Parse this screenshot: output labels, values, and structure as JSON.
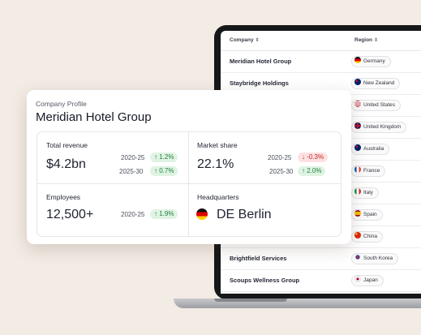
{
  "table": {
    "header_company": "Company",
    "header_region": "Region",
    "sort_glyph": "⇕",
    "rows": [
      {
        "company": "Meridian Hotel Group",
        "region": "Germany"
      },
      {
        "company": "Staybridge Holdings",
        "region": "New Zealand"
      },
      {
        "company": "",
        "region": "United States"
      },
      {
        "company": "",
        "region": "United Kingdom"
      },
      {
        "company": "",
        "region": "Australia"
      },
      {
        "company": "",
        "region": "France"
      },
      {
        "company": "",
        "region": "Italy"
      },
      {
        "company": "",
        "region": "Spain"
      },
      {
        "company": "",
        "region": "China"
      },
      {
        "company": "Brightfield Services",
        "region": "South Korea"
      },
      {
        "company": "Scoups Wellness Group",
        "region": "Japan"
      }
    ]
  },
  "card": {
    "subtitle": "Company Profile",
    "title": "Meridian Hotel Group",
    "revenue": {
      "label": "Total revenue",
      "value": "$4.2bn",
      "p1": "2020-25",
      "b1": "↑ 1.2%",
      "p2": "2025-30",
      "b2": "↑ 0.7%"
    },
    "market": {
      "label": "Market share",
      "value": "22.1%",
      "p1": "2020-25",
      "b1": "↓ -0.3%",
      "p2": "2025-30",
      "b2": "↑ 2.0%"
    },
    "employees": {
      "label": "Employees",
      "value": "12,500+",
      "p1": "2020-25",
      "b1": "↑ 1.9%"
    },
    "hq": {
      "label": "Headquarters",
      "value": "DE Berlin"
    }
  },
  "colors": {
    "up": "#23813c",
    "down": "#c62828",
    "background": "#f3ece5"
  },
  "icons": {
    "sort": "sort-icon",
    "flag": "flag-icon"
  }
}
